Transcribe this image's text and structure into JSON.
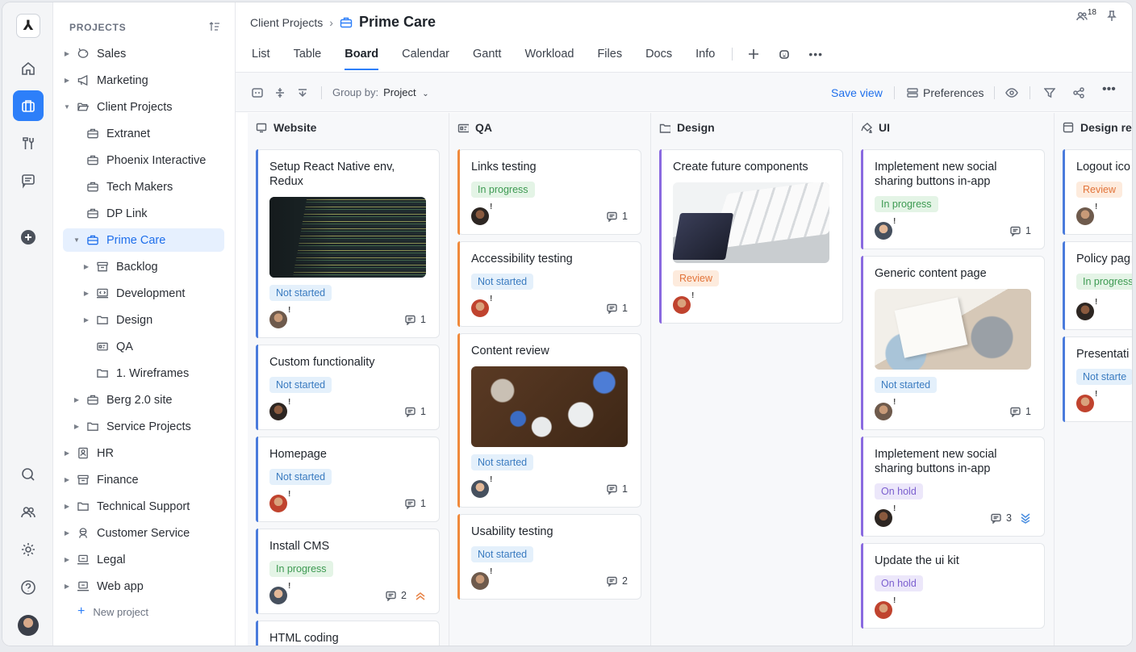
{
  "rail": {
    "logo": "⅄",
    "icons": [
      "home-icon",
      "briefcase-icon",
      "tools-icon",
      "chat-icon",
      "add-icon",
      "search-icon",
      "team-icon",
      "settings-icon",
      "help-icon"
    ]
  },
  "sidebar": {
    "heading": "PROJECTS",
    "items": [
      {
        "label": "Sales",
        "caret": "▶",
        "icon": "piggy-icon"
      },
      {
        "label": "Marketing",
        "caret": "▶",
        "icon": "megaphone-icon"
      },
      {
        "label": "Client Projects",
        "caret": "▼",
        "icon": "folder-open-icon"
      },
      {
        "label": "Extranet",
        "caret": "",
        "icon": "briefcase-icon"
      },
      {
        "label": "Phoenix Interactive",
        "caret": "",
        "icon": "briefcase-icon"
      },
      {
        "label": "Tech Makers",
        "caret": "",
        "icon": "briefcase-icon"
      },
      {
        "label": "DP Link",
        "caret": "",
        "icon": "briefcase-icon"
      },
      {
        "label": "Prime Care",
        "caret": "▼",
        "icon": "briefcase-icon"
      },
      {
        "label": "Backlog",
        "caret": "▶",
        "icon": "archive-icon"
      },
      {
        "label": "Development",
        "caret": "▶",
        "icon": "code-icon"
      },
      {
        "label": "Design",
        "caret": "▶",
        "icon": "folder-icon"
      },
      {
        "label": "QA",
        "caret": "",
        "icon": "qa-icon"
      },
      {
        "label": "1. Wireframes",
        "caret": "",
        "icon": "folder-icon"
      },
      {
        "label": "Berg 2.0 site",
        "caret": "▶",
        "icon": "briefcase-icon"
      },
      {
        "label": "Service Projects",
        "caret": "▶",
        "icon": "folder-icon"
      },
      {
        "label": "HR",
        "caret": "▶",
        "icon": "id-card-icon"
      },
      {
        "label": "Finance",
        "caret": "▶",
        "icon": "archive-icon"
      },
      {
        "label": "Technical Support",
        "caret": "▶",
        "icon": "folder-icon"
      },
      {
        "label": "Customer Service",
        "caret": "▶",
        "icon": "support-icon"
      },
      {
        "label": "Legal",
        "caret": "▶",
        "icon": "laptop-icon"
      },
      {
        "label": "Web app",
        "caret": "▶",
        "icon": "laptop-icon"
      }
    ],
    "new_project": "New project"
  },
  "header": {
    "breadcrumb_parent": "Client Projects",
    "breadcrumb_sep": "›",
    "title": "Prime Care",
    "members_count": "18"
  },
  "tabs": [
    "List",
    "Table",
    "Board",
    "Calendar",
    "Gantt",
    "Workload",
    "Files",
    "Docs",
    "Info"
  ],
  "active_tab": "Board",
  "toolbar": {
    "group_by_label": "Group by:",
    "group_by_value": "Project",
    "save_view": "Save view",
    "preferences": "Preferences"
  },
  "colors": {
    "accent": "#2d7ff9",
    "not_started": "#3a7bc0",
    "in_progress": "#3d9a52",
    "review": "#e2743a",
    "on_hold": "#7b5fcf"
  },
  "columns": [
    {
      "name": "Website",
      "icon": "monitor-icon",
      "cards": [
        {
          "title": "Setup React Native env, Redux",
          "thumb": "code",
          "status": "Not started",
          "comments": "1",
          "border": "blue"
        },
        {
          "title": "Custom functionality",
          "status": "Not started",
          "comments": "1",
          "border": "blue"
        },
        {
          "title": "Homepage",
          "status": "Not started",
          "comments": "1",
          "border": "blue"
        },
        {
          "title": "Install CMS",
          "status": "In progress",
          "comments": "2",
          "border": "blue",
          "priority": "high"
        },
        {
          "title": "HTML coding",
          "status": "",
          "comments": "",
          "border": "blue"
        }
      ]
    },
    {
      "name": "QA",
      "icon": "qa-icon",
      "cards": [
        {
          "title": "Links testing",
          "status": "In progress",
          "comments": "1",
          "border": "orange"
        },
        {
          "title": "Accessibility testing",
          "status": "Not started",
          "comments": "1",
          "border": "orange"
        },
        {
          "title": "Content review",
          "thumb": "desk",
          "status": "Not started",
          "comments": "1",
          "border": "orange"
        },
        {
          "title": "Usability testing",
          "status": "Not started",
          "comments": "2",
          "border": "orange"
        }
      ]
    },
    {
      "name": "Design",
      "icon": "folder-icon",
      "cards": [
        {
          "title": "Create future components",
          "thumb": "keys",
          "status": "Review",
          "comments": "",
          "border": "purple"
        }
      ]
    },
    {
      "name": "UI",
      "icon": "paint-icon",
      "cards": [
        {
          "title": "Impletement new social sharing buttons in-app",
          "status": "In progress",
          "comments": "1",
          "border": "purple"
        },
        {
          "title": "Generic content page",
          "thumb": "note",
          "status": "Not started",
          "comments": "1",
          "border": "purple"
        },
        {
          "title": "Impletement new social sharing buttons in-app",
          "status": "On hold",
          "comments": "3",
          "border": "purple",
          "priority": "low"
        },
        {
          "title": "Update the ui kit",
          "status": "On hold",
          "comments": "",
          "border": "purple"
        }
      ]
    },
    {
      "name": "Design re",
      "icon": "layout-icon",
      "cards": [
        {
          "title": "Logout ico",
          "status": "Review",
          "comments": "",
          "border": "blue"
        },
        {
          "title": "Policy pag",
          "status": "In progress",
          "comments": "",
          "border": "blue"
        },
        {
          "title": "Presentati",
          "status": "Not starte",
          "comments": "",
          "border": "blue"
        }
      ]
    }
  ]
}
